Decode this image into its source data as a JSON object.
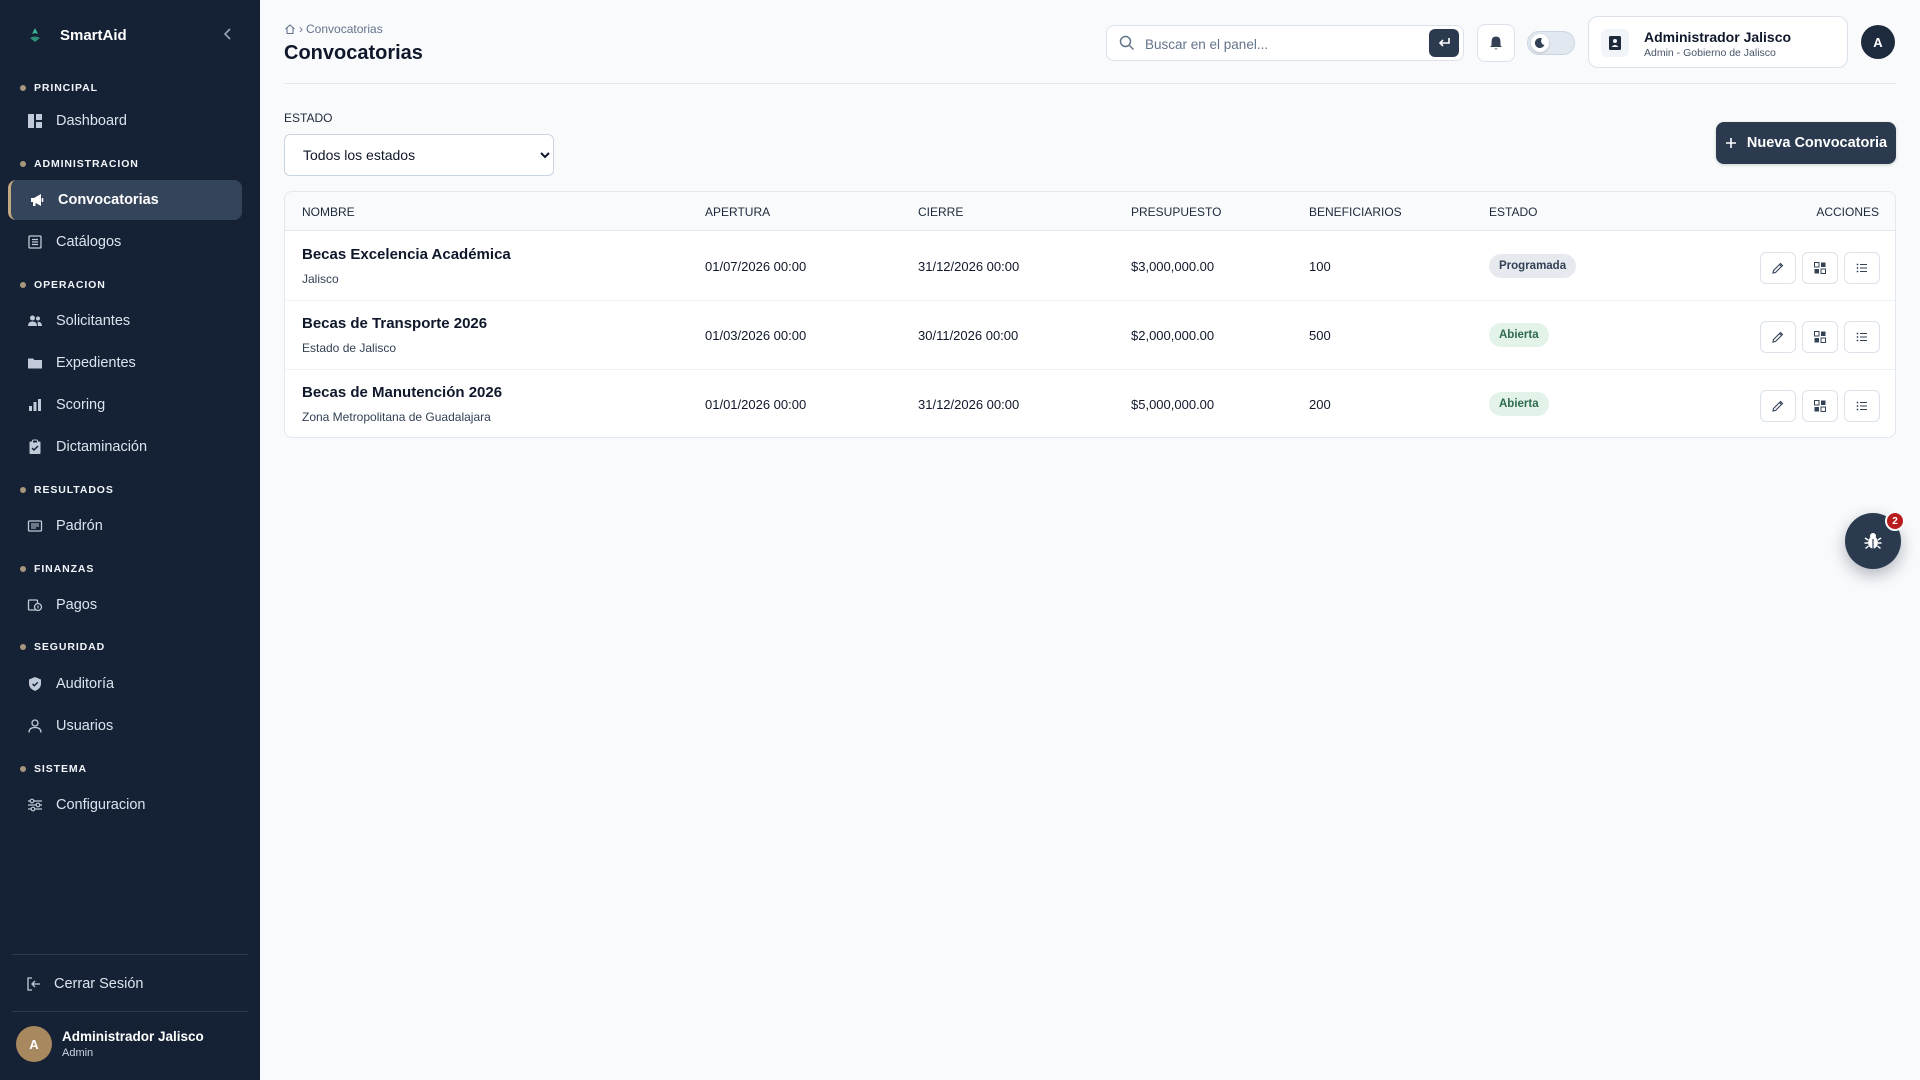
{
  "brand": {
    "name": "SmartAid"
  },
  "sidebar": {
    "sections": [
      {
        "label": "PRINCIPAL"
      },
      {
        "label": "ADMINISTRACION"
      },
      {
        "label": "OPERACION"
      },
      {
        "label": "RESULTADOS"
      },
      {
        "label": "FINANZAS"
      },
      {
        "label": "SEGURIDAD"
      },
      {
        "label": "SISTEMA"
      }
    ],
    "items": [
      {
        "label": "Dashboard",
        "icon": "dashboard-icon"
      },
      {
        "label": "Convocatorias",
        "icon": "megaphone-icon",
        "active": true
      },
      {
        "label": "Catálogos",
        "icon": "list-icon"
      },
      {
        "label": "Solicitantes",
        "icon": "users-icon"
      },
      {
        "label": "Expedientes",
        "icon": "folder-icon"
      },
      {
        "label": "Scoring",
        "icon": "bar-chart-icon"
      },
      {
        "label": "Dictaminación",
        "icon": "clipboard-icon"
      },
      {
        "label": "Padrón",
        "icon": "registry-icon"
      },
      {
        "label": "Pagos",
        "icon": "payments-icon"
      },
      {
        "label": "Auditoría",
        "icon": "shield-icon"
      },
      {
        "label": "Usuarios",
        "icon": "user-icon"
      },
      {
        "label": "Configuracion",
        "icon": "sliders-icon"
      }
    ],
    "logout_label": "Cerrar Sesión",
    "user": {
      "initial": "A",
      "name": "Administrador Jalisco",
      "role": "Admin"
    }
  },
  "header": {
    "breadcrumb": "Convocatorias",
    "title": "Convocatorias",
    "search_placeholder": "Buscar en el panel...",
    "user": {
      "name": "Administrador Jalisco",
      "role": "Admin - Gobierno de Jalisco",
      "initial": "A"
    }
  },
  "filters": {
    "estado_label": "ESTADO",
    "estado_selected": "Todos los estados"
  },
  "new_button_label": "Nueva Convocatoria",
  "table": {
    "columns": [
      "NOMBRE",
      "APERTURA",
      "CIERRE",
      "PRESUPUESTO",
      "BENEFICIARIOS",
      "ESTADO",
      "ACCIONES"
    ],
    "rows": [
      {
        "name": "Becas Excelencia Académica",
        "region": "Jalisco",
        "apertura": "01/07/2026 00:00",
        "cierre": "31/12/2026 00:00",
        "presupuesto": "$3,000,000.00",
        "beneficiarios": "100",
        "estado": "Programada",
        "estado_color": "#e6e9ee"
      },
      {
        "name": "Becas de Transporte 2026",
        "region": "Estado de Jalisco",
        "apertura": "01/03/2026 00:00",
        "cierre": "30/11/2026 00:00",
        "presupuesto": "$2,000,000.00",
        "beneficiarios": "500",
        "estado": "Abierta",
        "estado_color": "#e3f3ea"
      },
      {
        "name": "Becas de Manutención 2026",
        "region": "Zona Metropolitana de Guadalajara",
        "apertura": "01/01/2026 00:00",
        "cierre": "31/12/2026 00:00",
        "presupuesto": "$5,000,000.00",
        "beneficiarios": "200",
        "estado": "Abierta",
        "estado_color": "#e3f3ea"
      }
    ]
  },
  "fab": {
    "icon": "bug-icon",
    "badge": "2"
  },
  "colors": {
    "sidebar_bg": "#152235",
    "primary": "#2b3a4e",
    "accent": "#c2a87f"
  }
}
